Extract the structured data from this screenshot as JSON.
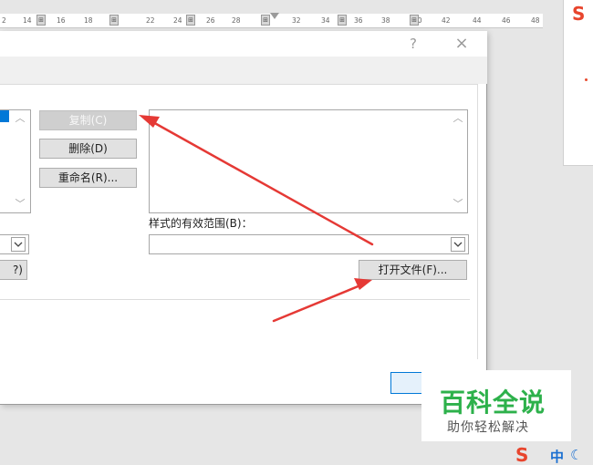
{
  "ruler": {
    "numbers": [
      "2",
      "14",
      "16",
      "18",
      "22",
      "24",
      "26",
      "28",
      "32",
      "34",
      "36",
      "38",
      "40",
      "42",
      "44",
      "46",
      "48"
    ]
  },
  "dialog": {
    "help_label": "?",
    "close_label": "×",
    "buttons": {
      "copy": "复制(C)",
      "delete": "删除(D)",
      "rename": "重命名(R)...",
      "left_partial": "?)",
      "open_file": "打开文件(F)..."
    },
    "scope_label": "样式的有效范围(B)：",
    "scope_value": ""
  },
  "watermark": {
    "title": "百科全说",
    "subtitle": "助你轻松解决"
  },
  "ime": {
    "logo": "S",
    "mode": "中",
    "moon": "☾"
  },
  "colors": {
    "annotation_arrow": "#e53935",
    "selection": "#0078d7",
    "watermark_green": "#2db14b"
  }
}
